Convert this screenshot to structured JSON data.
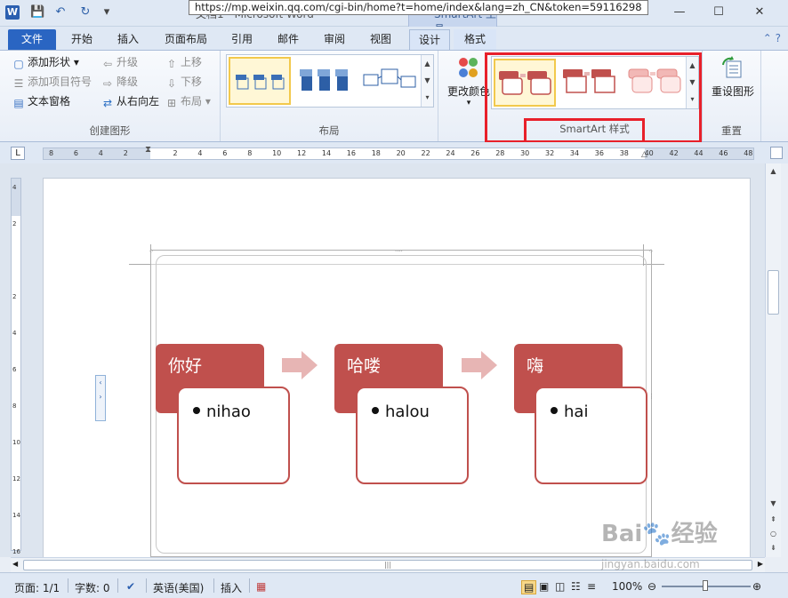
{
  "titlebar": {
    "doc_title": "文档1 - Microsoft Word",
    "url_tooltip": "https://mp.weixin.qq.com/cgi-bin/home?t=home/index&lang=zh_CN&token=59116298",
    "context_group": "SmartArt 工具",
    "word_logo": "W"
  },
  "tabs": {
    "file": "文件",
    "home": "开始",
    "insert": "插入",
    "page_layout": "页面布局",
    "references": "引用",
    "mailings": "邮件",
    "review": "审阅",
    "view": "视图",
    "design": "设计",
    "format": "格式"
  },
  "ribbon": {
    "create_graphic": {
      "label": "创建图形",
      "add_shape": "添加形状",
      "add_bullet": "添加项目符号",
      "text_pane": "文本窗格",
      "promote": "升级",
      "demote": "降级",
      "right_to_left": "从右向左",
      "move_up": "上移",
      "move_down": "下移",
      "layout": "布局"
    },
    "layouts": {
      "label": "布局"
    },
    "change_colors": "更改颜色",
    "styles": {
      "label": "SmartArt 样式"
    },
    "reset": {
      "label": "重置",
      "reset_graphic": "重设图形"
    }
  },
  "ruler": {
    "h_numbers": [
      "8",
      "6",
      "4",
      "2",
      "",
      "2",
      "4",
      "6",
      "8",
      "10",
      "12",
      "14",
      "16",
      "18",
      "20",
      "22",
      "24",
      "26",
      "28",
      "30",
      "32",
      "34",
      "36",
      "38",
      "40",
      "42",
      "44",
      "46",
      "48"
    ],
    "v_numbers": [
      "4",
      "2",
      "",
      "2",
      "4",
      "6",
      "8",
      "10",
      "12",
      "14",
      "16"
    ]
  },
  "smartart": {
    "items": [
      {
        "title": "你好",
        "bullet": "nihao"
      },
      {
        "title": "哈喽",
        "bullet": "halou"
      },
      {
        "title": "嗨",
        "bullet": "hai"
      }
    ],
    "colors": {
      "accent": "#c0504d",
      "arrow": "#e7b5b4"
    }
  },
  "status": {
    "page": "页面: 1/1",
    "words": "字数: 0",
    "language": "英语(美国)",
    "mode": "插入",
    "zoom": "100%"
  },
  "watermark": {
    "brand": "Bai🐾经验",
    "site": "jingyan.baidu.com"
  },
  "icons": [
    "save-icon",
    "undo-icon",
    "redo-icon",
    "minimize-icon",
    "maximize-icon",
    "close-icon",
    "help-icon"
  ]
}
